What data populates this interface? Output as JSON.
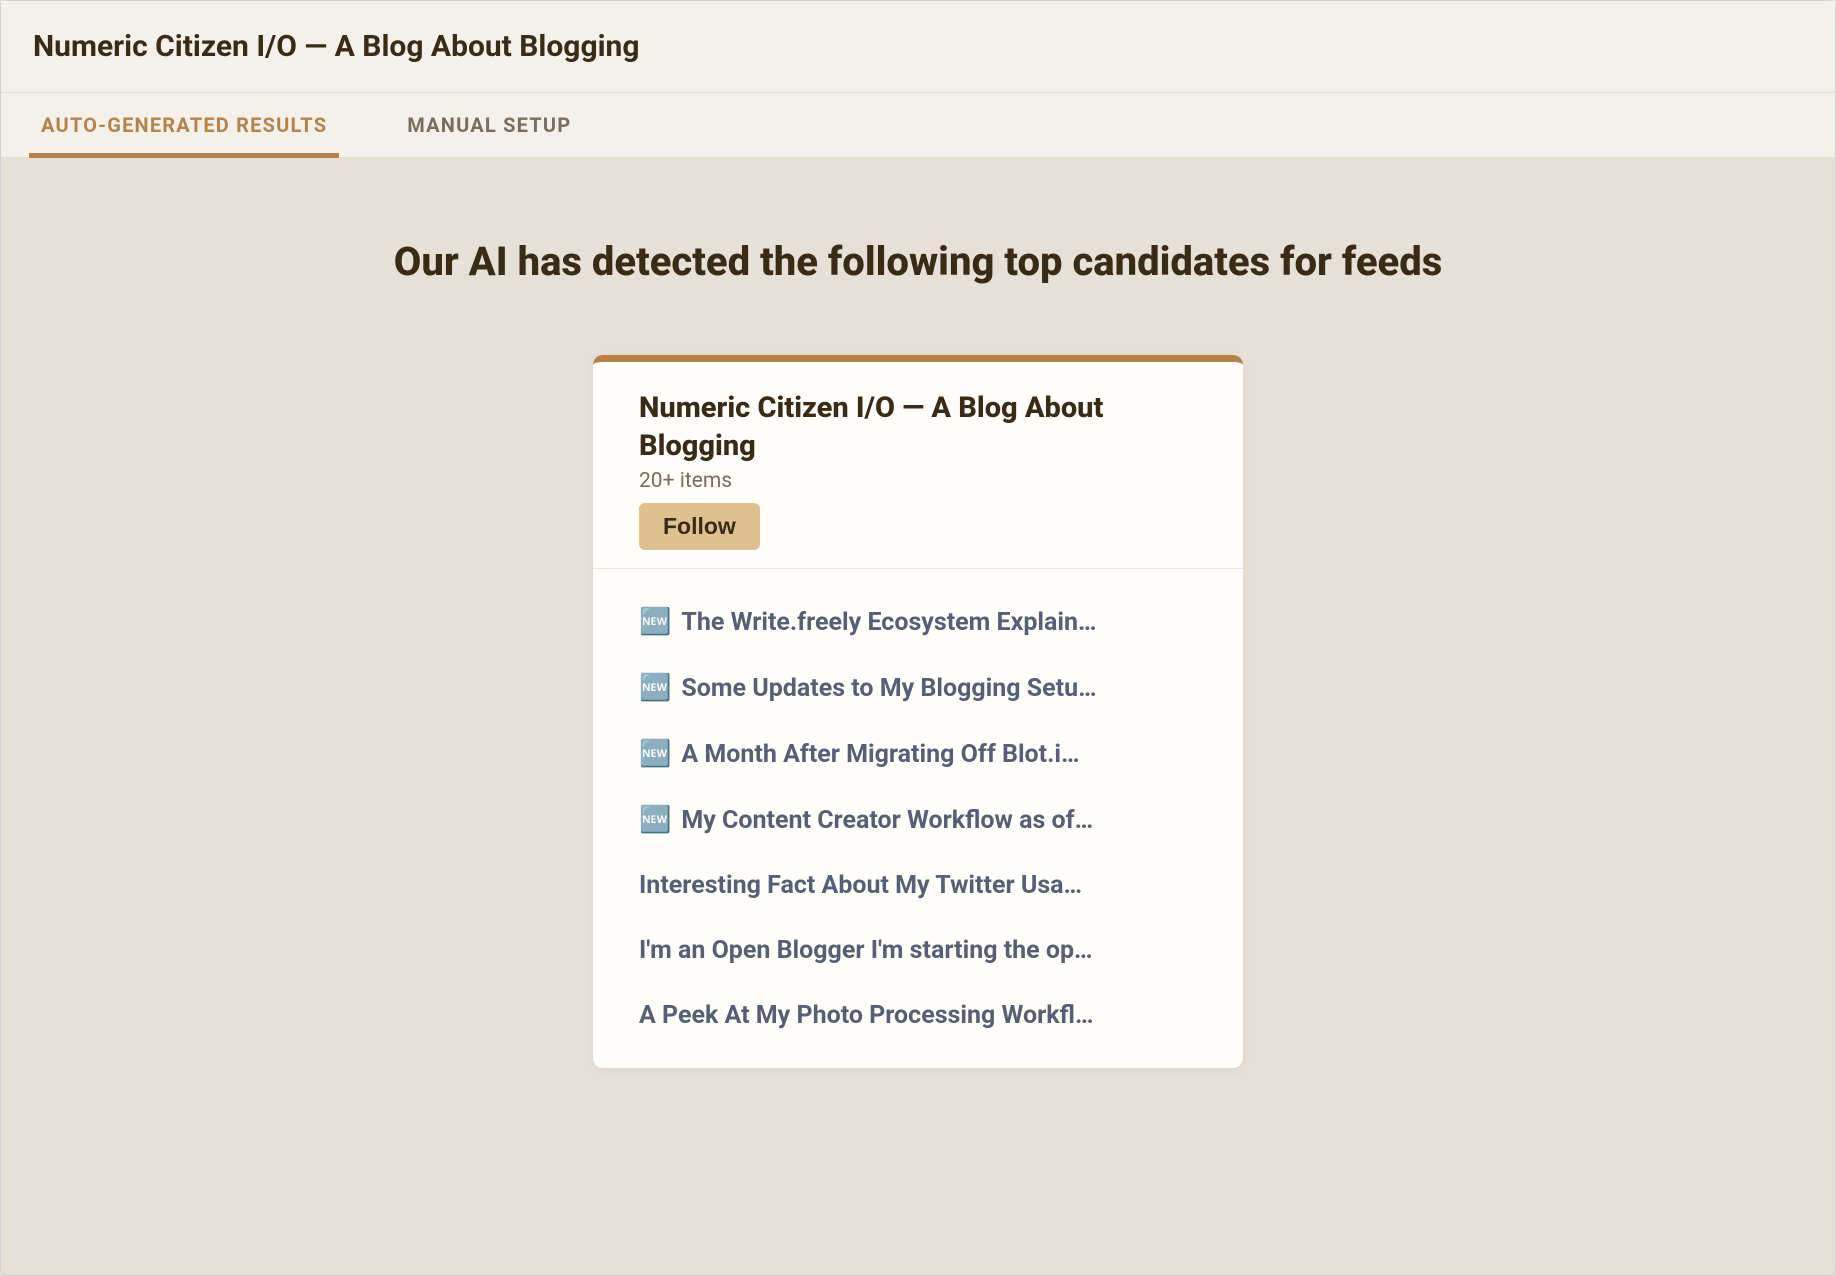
{
  "header": {
    "title": "Numeric Citizen I/O — A Blog About Blogging"
  },
  "tabs": {
    "auto": "AUTO-GENERATED RESULTS",
    "manual": "MANUAL SETUP"
  },
  "content": {
    "headline": "Our AI has detected the following top candidates for feeds"
  },
  "card": {
    "title": "Numeric Citizen I/O — A Blog About Blogging",
    "subtitle": "20+ items",
    "follow_label": "Follow",
    "items": [
      {
        "icon": "🆕",
        "text": "The Write.freely Ecosystem Explain…"
      },
      {
        "icon": "🆕",
        "text": "Some Updates to My Blogging Setu…"
      },
      {
        "icon": "🆕",
        "text": "A Month After Migrating Off Blot.i…"
      },
      {
        "icon": "🆕",
        "text": "My Content Creator Workflow as of…"
      },
      {
        "icon": "",
        "text": "Interesting Fact About My Twitter Usa…"
      },
      {
        "icon": "",
        "text": "I'm an Open Blogger I'm starting the op…"
      },
      {
        "icon": "",
        "text": "A Peek At My Photo Processing Workfl…"
      }
    ]
  }
}
